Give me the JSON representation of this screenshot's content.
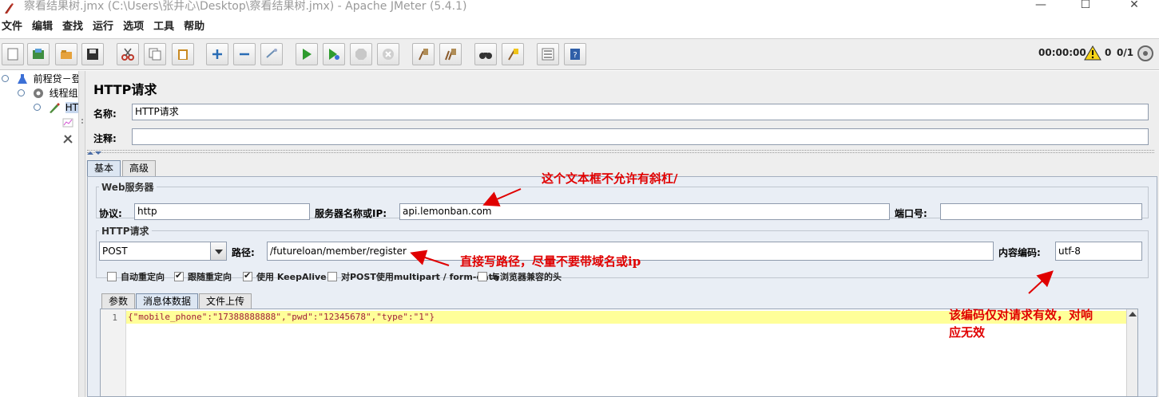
{
  "window": {
    "title": "察看结果树.jmx (C:\\Users\\张井心\\Desktop\\察看结果树.jmx) - Apache JMeter (5.4.1)",
    "min_glyph": "—",
    "max_glyph": "☐",
    "close_glyph": "✕"
  },
  "menu": [
    "文件",
    "编辑",
    "查找",
    "运行",
    "选项",
    "工具",
    "帮助"
  ],
  "toolbar": {
    "timer": "00:00:00",
    "warning_count": "0",
    "threads": "0/1"
  },
  "tree": {
    "items": [
      {
        "label": "前程贷－登"
      },
      {
        "label": "线程组"
      },
      {
        "label": "HTTP请求"
      },
      {
        "label": ""
      },
      {
        "label": ""
      }
    ]
  },
  "panel": {
    "title": "HTTP请求",
    "name_label": "名称:",
    "name_value": "HTTP请求",
    "comment_label": "注释:",
    "comment_value": ""
  },
  "tabs": [
    "基本",
    "高级"
  ],
  "web_server": {
    "group_title": "Web服务器",
    "protocol_label": "协议:",
    "protocol_value": "http",
    "server_label": "服务器名称或IP:",
    "server_value": "api.lemonban.com",
    "port_label": "端口号:",
    "port_value": ""
  },
  "http_request": {
    "group_title": "HTTP请求",
    "method": "POST",
    "path_label": "路径:",
    "path_value": "/futureloan/member/register",
    "encoding_label": "内容编码:",
    "encoding_value": "utf-8"
  },
  "checkboxes": [
    {
      "label": "自动重定向",
      "checked": false
    },
    {
      "label": "跟随重定向",
      "checked": true
    },
    {
      "label": "使用 KeepAlive",
      "checked": true
    },
    {
      "label": "对POST使用multipart / form-data",
      "checked": false
    },
    {
      "label": "与浏览器兼容的头",
      "checked": false
    }
  ],
  "subtabs": [
    "参数",
    "消息体数据",
    "文件上传"
  ],
  "body_editor": {
    "line_number": "1",
    "code": "{\"mobile_phone\":\"17388888888\",\"pwd\":\"12345678\",\"type\":\"1\"}"
  },
  "annotations": {
    "server_note": "这个文本框不允许有斜杠/",
    "path_note": "直接写路径，尽量不要带域名或ip",
    "encoding_note_line1": "该编码仅对请求有效，对响",
    "encoding_note_line2": "应无效"
  },
  "colors": {
    "annotation": "#e00000",
    "editor_highlight": "#ffff99",
    "code_text": "#a0203a"
  }
}
